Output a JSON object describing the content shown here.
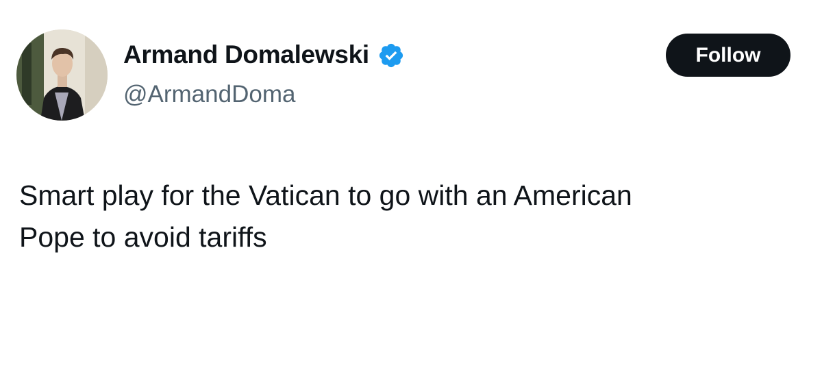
{
  "author": {
    "display_name": "Armand Domalewski",
    "handle": "@ArmandDoma",
    "verified": true,
    "verified_icon": "verified-badge-icon",
    "verified_color": "#1d9bf0"
  },
  "actions": {
    "follow_label": "Follow"
  },
  "tweet": {
    "text": "Smart play for the Vatican to go with an American\nPope to avoid tariffs"
  },
  "colors": {
    "text_primary": "#0f1419",
    "text_secondary": "#536471",
    "follow_button_bg": "#0f1419",
    "follow_button_text": "#ffffff"
  }
}
